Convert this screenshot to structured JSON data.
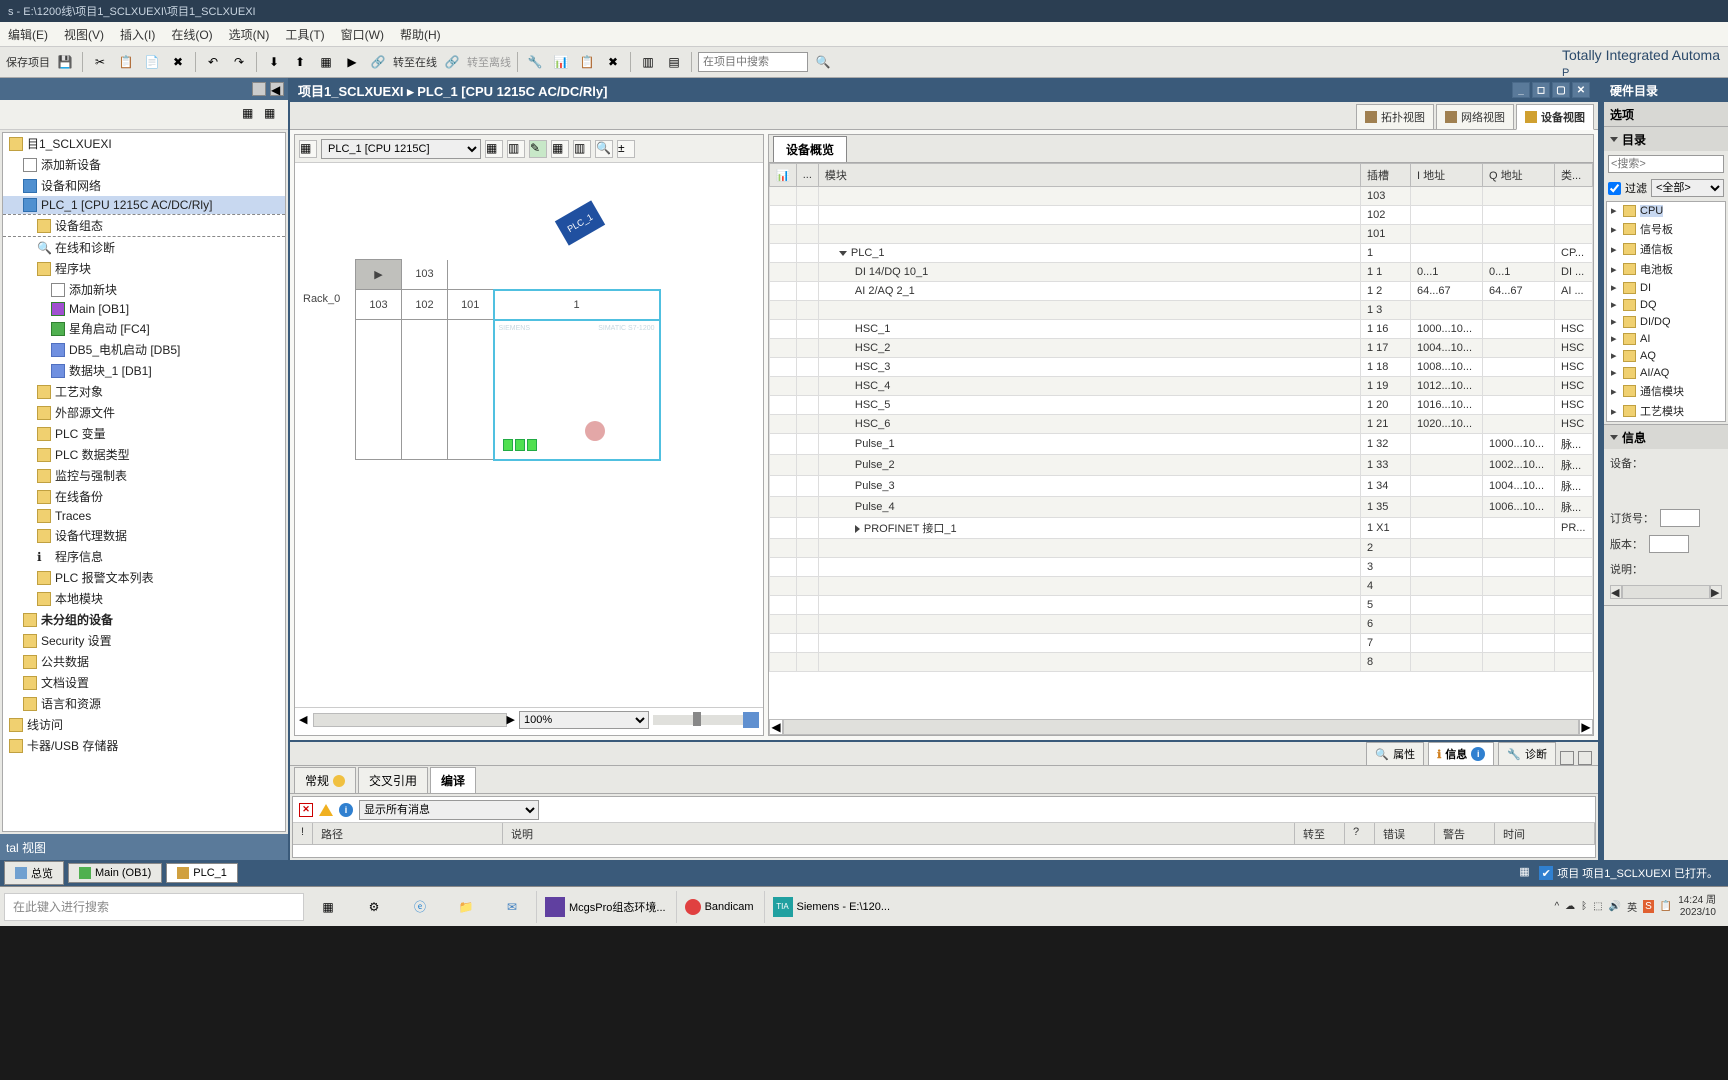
{
  "title": "s - E:\\1200线\\项目1_SCLXUEXI\\项目1_SCLXUEXI",
  "menu": [
    "编辑(E)",
    "视图(V)",
    "插入(I)",
    "在线(O)",
    "选项(N)",
    "工具(T)",
    "窗口(W)",
    "帮助(H)"
  ],
  "toolbar": {
    "save_project": "保存项目",
    "go_online": "转至在线",
    "go_offline": "转至离线",
    "search_placeholder": "在项目中搜索"
  },
  "brand": "Totally Integrated Automa",
  "brand2": "P",
  "breadcrumb": "项目1_SCLXUEXI ▸ PLC_1 [CPU 1215C AC/DC/Rly]",
  "tree": {
    "root": "目1_SCLXUEXI",
    "items": [
      "添加新设备",
      "设备和网络",
      "PLC_1 [CPU 1215C AC/DC/Rly]",
      "设备组态",
      "在线和诊断",
      "程序块",
      "添加新块",
      "Main [OB1]",
      "星角启动 [FC4]",
      "DB5_电机启动 [DB5]",
      "数据块_1 [DB1]",
      "工艺对象",
      "外部源文件",
      "PLC 变量",
      "PLC 数据类型",
      "监控与强制表",
      "在线备份",
      "Traces",
      "设备代理数据",
      "程序信息",
      "PLC 报警文本列表",
      "本地模块",
      "未分组的设备",
      "Security 设置",
      "公共数据",
      "文档设置",
      "语言和资源",
      "线访问",
      "卡器/USB 存储器"
    ]
  },
  "left_footer": "tal 视图",
  "view_tabs": {
    "topology": "拓扑视图",
    "network": "网络视图",
    "device": "设备视图"
  },
  "rack": {
    "selector": "PLC_1 [CPU 1215C]",
    "zoom": "100%",
    "label": "PLC_1",
    "rack_label": "Rack_0",
    "slots": [
      "103",
      "102",
      "101",
      "1"
    ],
    "module_name": "SIEMENS",
    "module_type": "SIMATIC S7-1200"
  },
  "overview": {
    "tab": "设备概览",
    "cols": {
      "module": "模块",
      "slot": "插槽",
      "iaddr": "I 地址",
      "qaddr": "Q 地址",
      "type": "类..."
    },
    "rows": [
      {
        "name": "",
        "slot": "103",
        "i": "",
        "q": "",
        "t": ""
      },
      {
        "name": "",
        "slot": "102",
        "i": "",
        "q": "",
        "t": ""
      },
      {
        "name": "",
        "slot": "101",
        "i": "",
        "q": "",
        "t": ""
      },
      {
        "name": "PLC_1",
        "slot": "1",
        "i": "",
        "q": "",
        "t": "CP...",
        "exp": "down",
        "ind": 1
      },
      {
        "name": "DI 14/DQ 10_1",
        "slot": "1 1",
        "i": "0...1",
        "q": "0...1",
        "t": "DI ...",
        "ind": 2
      },
      {
        "name": "AI 2/AQ 2_1",
        "slot": "1 2",
        "i": "64...67",
        "q": "64...67",
        "t": "AI ...",
        "ind": 2
      },
      {
        "name": "",
        "slot": "1 3",
        "i": "",
        "q": "",
        "t": ""
      },
      {
        "name": "HSC_1",
        "slot": "1 16",
        "i": "1000...10...",
        "q": "",
        "t": "HSC",
        "ind": 2
      },
      {
        "name": "HSC_2",
        "slot": "1 17",
        "i": "1004...10...",
        "q": "",
        "t": "HSC",
        "ind": 2
      },
      {
        "name": "HSC_3",
        "slot": "1 18",
        "i": "1008...10...",
        "q": "",
        "t": "HSC",
        "ind": 2
      },
      {
        "name": "HSC_4",
        "slot": "1 19",
        "i": "1012...10...",
        "q": "",
        "t": "HSC",
        "ind": 2
      },
      {
        "name": "HSC_5",
        "slot": "1 20",
        "i": "1016...10...",
        "q": "",
        "t": "HSC",
        "ind": 2
      },
      {
        "name": "HSC_6",
        "slot": "1 21",
        "i": "1020...10...",
        "q": "",
        "t": "HSC",
        "ind": 2
      },
      {
        "name": "Pulse_1",
        "slot": "1 32",
        "i": "",
        "q": "1000...10...",
        "t": "脉...",
        "ind": 2
      },
      {
        "name": "Pulse_2",
        "slot": "1 33",
        "i": "",
        "q": "1002...10...",
        "t": "脉...",
        "ind": 2
      },
      {
        "name": "Pulse_3",
        "slot": "1 34",
        "i": "",
        "q": "1004...10...",
        "t": "脉...",
        "ind": 2
      },
      {
        "name": "Pulse_4",
        "slot": "1 35",
        "i": "",
        "q": "1006...10...",
        "t": "脉...",
        "ind": 2
      },
      {
        "name": "PROFINET 接口_1",
        "slot": "1 X1",
        "i": "",
        "q": "",
        "t": "PR...",
        "exp": "right",
        "ind": 2
      },
      {
        "name": "",
        "slot": "2",
        "i": "",
        "q": "",
        "t": ""
      },
      {
        "name": "",
        "slot": "3",
        "i": "",
        "q": "",
        "t": ""
      },
      {
        "name": "",
        "slot": "4",
        "i": "",
        "q": "",
        "t": ""
      },
      {
        "name": "",
        "slot": "5",
        "i": "",
        "q": "",
        "t": ""
      },
      {
        "name": "",
        "slot": "6",
        "i": "",
        "q": "",
        "t": ""
      },
      {
        "name": "",
        "slot": "7",
        "i": "",
        "q": "",
        "t": ""
      },
      {
        "name": "",
        "slot": "8",
        "i": "",
        "q": "",
        "t": ""
      }
    ]
  },
  "info_tabs": {
    "properties": "属性",
    "info": "信息",
    "diag": "诊断"
  },
  "info_subtabs": {
    "general": "常规",
    "xref": "交叉引用",
    "compile": "编译"
  },
  "info_filter": "显示所有消息",
  "info_cols": [
    "!",
    "路径",
    "说明",
    "转至",
    "?",
    "错误",
    "警告",
    "时间"
  ],
  "right": {
    "title": "硬件目录",
    "options": "选项",
    "catalog": "目录",
    "search_placeholder": "<搜索>",
    "filter": "过滤",
    "filter_val": "<全部>",
    "info": "信息",
    "device": "设备：",
    "order": "订货号：",
    "version": "版本：",
    "desc": "说明：",
    "cats": [
      "CPU",
      "信号板",
      "通信板",
      "电池板",
      "DI",
      "DQ",
      "DI/DQ",
      "AI",
      "AQ",
      "AI/AQ",
      "通信模块",
      "工艺模块"
    ]
  },
  "bottom": {
    "tabs": [
      "总览",
      "Main (OB1)",
      "PLC_1"
    ],
    "status": "项目 项目1_SCLXUEXI 已打开。"
  },
  "taskbar": {
    "search": "在此键入进行搜索",
    "apps": [
      {
        "label": "McgsPro组态环境..."
      },
      {
        "label": "Bandicam"
      },
      {
        "label": "Siemens - E:\\120..."
      }
    ],
    "time": "14:24 周",
    "date": "2023/10"
  }
}
